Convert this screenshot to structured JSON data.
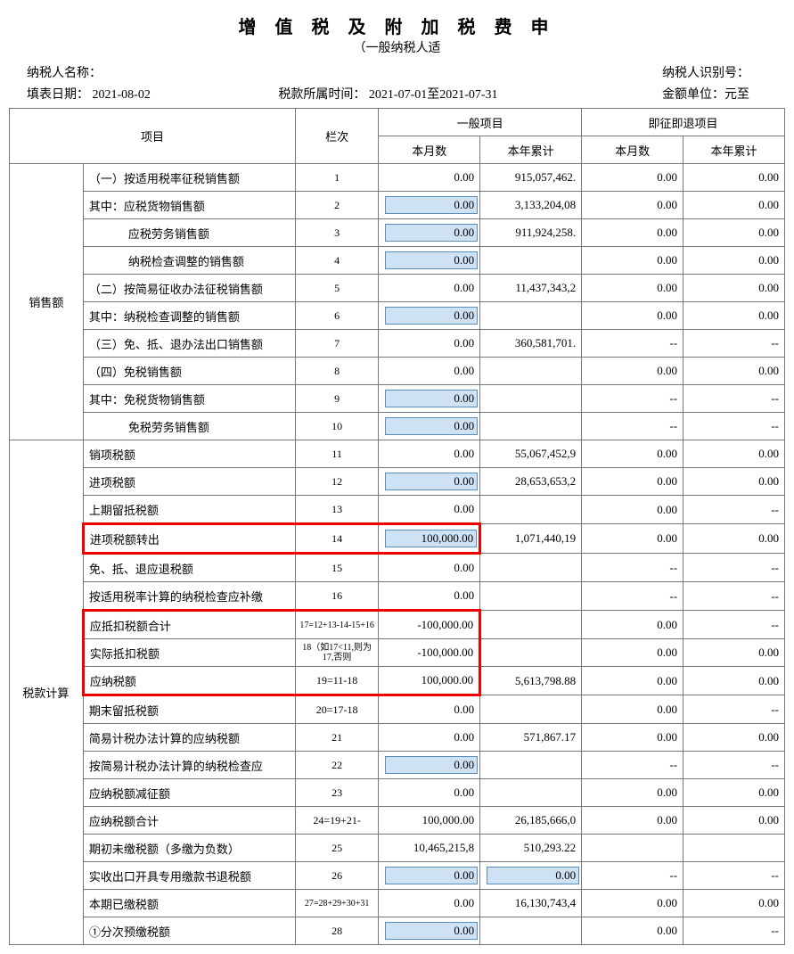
{
  "title": "增 值 税 及 附 加 税 费 申",
  "subtitle": "（一般纳税人适",
  "meta": {
    "name_label": "纳税人名称：",
    "id_label": "纳税人识别号：",
    "fill_date_label": "填表日期：",
    "fill_date": "2021-08-02",
    "period_label": "税款所属时间：",
    "period": "2021-07-01至2021-07-31",
    "unit_label": "金额单位：元至"
  },
  "headers": {
    "item": "项目",
    "col": "栏次",
    "general": "一般项目",
    "refund": "即征即退项目",
    "month": "本月数",
    "year": "本年累计"
  },
  "groups": {
    "sales": "销售额",
    "tax": "税款计算"
  },
  "rows": [
    {
      "id": "r1",
      "label": "（一）按适用税率征税销售额",
      "col": "1",
      "m_inp": false,
      "m": "0.00",
      "y": "915,057,462.",
      "rm": "0.00",
      "ry": "0.00"
    },
    {
      "id": "r2",
      "label": "其中：应税货物销售额",
      "col": "2",
      "m_inp": true,
      "m": "0.00",
      "y": "3,133,204,08",
      "rm": "0.00",
      "ry": "0.00"
    },
    {
      "id": "r3",
      "label": "应税劳务销售额",
      "indent": true,
      "col": "3",
      "m_inp": true,
      "m": "0.00",
      "y": "911,924,258.",
      "rm": "0.00",
      "ry": "0.00"
    },
    {
      "id": "r4",
      "label": "纳税检查调整的销售额",
      "indent": true,
      "col": "4",
      "m_inp": true,
      "m": "0.00",
      "y": "",
      "rm": "0.00",
      "ry": "0.00"
    },
    {
      "id": "r5",
      "label": "（二）按简易征收办法征税销售额",
      "col": "5",
      "m_inp": false,
      "m": "0.00",
      "y": "11,437,343,2",
      "rm": "0.00",
      "ry": "0.00"
    },
    {
      "id": "r6",
      "label": "其中：纳税检查调整的销售额",
      "col": "6",
      "m_inp": true,
      "m": "0.00",
      "y": "",
      "rm": "0.00",
      "ry": "0.00"
    },
    {
      "id": "r7",
      "label": "（三）免、抵、退办法出口销售额",
      "col": "7",
      "m_inp": false,
      "m": "0.00",
      "y": "360,581,701.",
      "rm": "--",
      "ry": "--"
    },
    {
      "id": "r8",
      "label": "（四）免税销售额",
      "col": "8",
      "m_inp": false,
      "m": "0.00",
      "y": "",
      "rm": "0.00",
      "ry": "0.00"
    },
    {
      "id": "r9",
      "label": "其中：免税货物销售额",
      "col": "9",
      "m_inp": true,
      "m": "0.00",
      "y": "",
      "rm": "--",
      "ry": "--"
    },
    {
      "id": "r10",
      "label": "免税劳务销售额",
      "indent": true,
      "col": "10",
      "m_inp": true,
      "m": "0.00",
      "y": "",
      "rm": "--",
      "ry": "--"
    },
    {
      "id": "r11",
      "label": "销项税额",
      "col": "11",
      "m_inp": false,
      "m": "0.00",
      "y": "55,067,452,9",
      "rm": "0.00",
      "ry": "0.00"
    },
    {
      "id": "r12",
      "label": "进项税额",
      "col": "12",
      "m_inp": true,
      "m": "0.00",
      "y": "28,653,653,2",
      "rm": "0.00",
      "ry": "0.00"
    },
    {
      "id": "r13",
      "label": "上期留抵税额",
      "col": "13",
      "m_inp": false,
      "m": "0.00",
      "y": "",
      "rm": "0.00",
      "ry": "--"
    },
    {
      "id": "r14",
      "label": "进项税额转出",
      "col": "14",
      "m_inp": true,
      "m": "100,000.00",
      "y": "1,071,440,19",
      "rm": "0.00",
      "ry": "0.00",
      "hl": "row14"
    },
    {
      "id": "r15",
      "label": "免、抵、退应退税额",
      "col": "15",
      "m_inp": false,
      "m": "0.00",
      "y": "",
      "rm": "--",
      "ry": "--"
    },
    {
      "id": "r16",
      "label": "按适用税率计算的纳税检查应补缴",
      "col": "16",
      "m_inp": false,
      "m": "0.00",
      "y": "",
      "rm": "--",
      "ry": "--"
    },
    {
      "id": "r17",
      "label": "应抵扣税额合计",
      "col": "17=12+13-14-15+16",
      "small": true,
      "m_inp": false,
      "m": "-100,000.00",
      "y": "",
      "rm": "0.00",
      "ry": "--",
      "hl": "blockTop"
    },
    {
      "id": "r18",
      "label": "实际抵扣税额",
      "col": "18（如17<11,则为17,否则",
      "small": true,
      "m_inp": false,
      "m": "-100,000.00",
      "y": "",
      "rm": "0.00",
      "ry": "0.00",
      "hl": "blockMid"
    },
    {
      "id": "r19",
      "label": "应纳税额",
      "col": "19=11-18",
      "m_inp": false,
      "m": "100,000.00",
      "y": "5,613,798.88",
      "rm": "0.00",
      "ry": "0.00",
      "hl": "blockBot"
    },
    {
      "id": "r20",
      "label": "期末留抵税额",
      "col": "20=17-18",
      "m_inp": false,
      "m": "0.00",
      "y": "",
      "rm": "0.00",
      "ry": "--"
    },
    {
      "id": "r21",
      "label": "简易计税办法计算的应纳税额",
      "col": "21",
      "m_inp": false,
      "m": "0.00",
      "y": "571,867.17",
      "rm": "0.00",
      "ry": "0.00"
    },
    {
      "id": "r22",
      "label": "按简易计税办法计算的纳税检查应",
      "col": "22",
      "m_inp": true,
      "m": "0.00",
      "y": "",
      "rm": "--",
      "ry": "--"
    },
    {
      "id": "r23",
      "label": "应纳税额减征额",
      "col": "23",
      "m_inp": false,
      "m": "0.00",
      "y": "",
      "rm": "0.00",
      "ry": "0.00"
    },
    {
      "id": "r24",
      "label": "应纳税额合计",
      "col": "24=19+21-",
      "m_inp": false,
      "m": "100,000.00",
      "y": "26,185,666,0",
      "rm": "0.00",
      "ry": "0.00"
    },
    {
      "id": "r25",
      "label": "期初未缴税额（多缴为负数）",
      "col": "25",
      "m_inp": false,
      "m": "10,465,215,8",
      "y": "510,293.22",
      "rm": "",
      "ry": ""
    },
    {
      "id": "r26",
      "label": "实收出口开具专用缴款书退税额",
      "col": "26",
      "m_inp": true,
      "m": "0.00",
      "y_inp": true,
      "y": "0.00",
      "rm": "--",
      "ry": "--"
    },
    {
      "id": "r27",
      "label": "本期已缴税额",
      "col": "27=28+29+30+31",
      "small": true,
      "m_inp": false,
      "m": "0.00",
      "y": "16,130,743,4",
      "rm": "0.00",
      "ry": "0.00"
    },
    {
      "id": "r28",
      "label": "①分次预缴税额",
      "col": "28",
      "m_inp": true,
      "m": "0.00",
      "y": "",
      "rm": "0.00",
      "ry": "--"
    }
  ]
}
